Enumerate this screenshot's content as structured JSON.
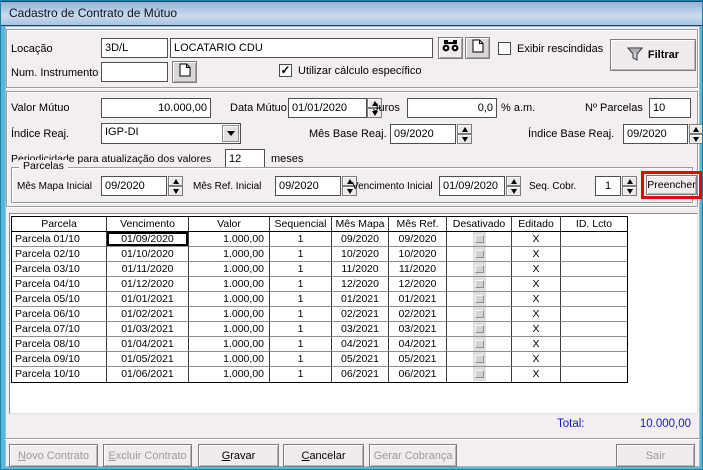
{
  "window": {
    "title": "Cadastro de Contrato de Mútuo"
  },
  "header": {
    "locacao_label": "Locação",
    "locacao_code": "3D/L",
    "locacao_name": "LOCATARIO CDU",
    "exibir_rescindidas_label": "Exibir rescindidas",
    "exibir_rescindidas_checked": false,
    "filtrar_label": "Filtrar",
    "num_instrumento_label": "Num. Instrumento",
    "num_instrumento_value": "",
    "utilizar_calculo_label": "Utilizar cálculo específico",
    "utilizar_calculo_checked": true,
    "utilizar_calculo_mark": "✓"
  },
  "contract": {
    "valor_mutuo_label": "Valor Mútuo",
    "valor_mutuo": "10.000,00",
    "data_mutuo_label": "Data Mútuo",
    "data_mutuo": "01/01/2020",
    "juros_label": "Juros",
    "juros": "0,0",
    "juros_suffix": "% a.m.",
    "num_parcelas_label": "Nº Parcelas",
    "num_parcelas": "10",
    "indice_reaj_label": "Índice Reaj.",
    "indice_reaj": "IGP-DI",
    "mes_base_label": "Mês Base Reaj.",
    "mes_base": "09/2020",
    "indice_base_label": "Índice Base Reaj.",
    "indice_base": "09/2020",
    "periodicidade_label": "Periodicidade para atualização dos valores",
    "periodicidade": "12",
    "periodicidade_suffix": "meses"
  },
  "parcelas_box": {
    "title": "Parcelas",
    "mes_mapa_label": "Mês Mapa Inicial",
    "mes_mapa": "09/2020",
    "mes_ref_label": "Mês Ref. Inicial",
    "mes_ref": "09/2020",
    "vencimento_label": "Vencimento Inicial",
    "vencimento": "01/09/2020",
    "seq_cobr_label": "Seq. Cobr.",
    "seq_cobr": "1",
    "preencher_label": "Preencher"
  },
  "grid": {
    "columns": [
      "Parcela",
      "Vencimento",
      "Valor",
      "Sequencial",
      "Mês Mapa",
      "Mês Ref.",
      "Desativado",
      "Editado",
      "ID. Lcto"
    ],
    "rows": [
      [
        "Parcela 01/10",
        "01/09/2020",
        "1.000,00",
        "1",
        "09/2020",
        "09/2020",
        "",
        "X",
        ""
      ],
      [
        "Parcela 02/10",
        "01/10/2020",
        "1.000,00",
        "1",
        "10/2020",
        "10/2020",
        "",
        "X",
        ""
      ],
      [
        "Parcela 03/10",
        "01/11/2020",
        "1.000,00",
        "1",
        "11/2020",
        "11/2020",
        "",
        "X",
        ""
      ],
      [
        "Parcela 04/10",
        "01/12/2020",
        "1.000,00",
        "1",
        "12/2020",
        "12/2020",
        "",
        "X",
        ""
      ],
      [
        "Parcela 05/10",
        "01/01/2021",
        "1.000,00",
        "1",
        "01/2021",
        "01/2021",
        "",
        "X",
        ""
      ],
      [
        "Parcela 06/10",
        "01/02/2021",
        "1.000,00",
        "1",
        "02/2021",
        "02/2021",
        "",
        "X",
        ""
      ],
      [
        "Parcela 07/10",
        "01/03/2021",
        "1.000,00",
        "1",
        "03/2021",
        "03/2021",
        "",
        "X",
        ""
      ],
      [
        "Parcela 08/10",
        "01/04/2021",
        "1.000,00",
        "1",
        "04/2021",
        "04/2021",
        "",
        "X",
        ""
      ],
      [
        "Parcela 09/10",
        "01/05/2021",
        "1.000,00",
        "1",
        "05/2021",
        "05/2021",
        "",
        "X",
        ""
      ],
      [
        "Parcela 10/10",
        "01/06/2021",
        "1.000,00",
        "1",
        "06/2021",
        "06/2021",
        "",
        "X",
        ""
      ]
    ],
    "focused_cell": {
      "row": 0,
      "col": 1
    }
  },
  "footer": {
    "total_label": "Total:",
    "total_value": "10.000,00",
    "buttons": [
      {
        "name": "novo-contrato-button",
        "label": "Novo Contrato",
        "mnemonic": "N",
        "enabled": false
      },
      {
        "name": "excluir-contrato-button",
        "label": "Excluir Contrato",
        "mnemonic": "E",
        "enabled": false
      },
      {
        "name": "gravar-button",
        "label": "Gravar",
        "mnemonic": "G",
        "enabled": true
      },
      {
        "name": "cancelar-button",
        "label": "Cancelar",
        "mnemonic": "C",
        "enabled": true
      },
      {
        "name": "gerar-cobranca-button",
        "label": "Gerar Cobrança",
        "mnemonic": "",
        "enabled": false
      },
      {
        "name": "sair-button",
        "label": "Sair",
        "mnemonic": "",
        "enabled": false
      }
    ]
  },
  "colors": {
    "frame": "#52b8dc",
    "form_bg": "#f2eef1",
    "highlight_red": "#dd0a0a",
    "total_blue": "#1717c8",
    "titlebar_top": "#8fb0d2",
    "titlebar_bottom": "#a9c4e2"
  }
}
